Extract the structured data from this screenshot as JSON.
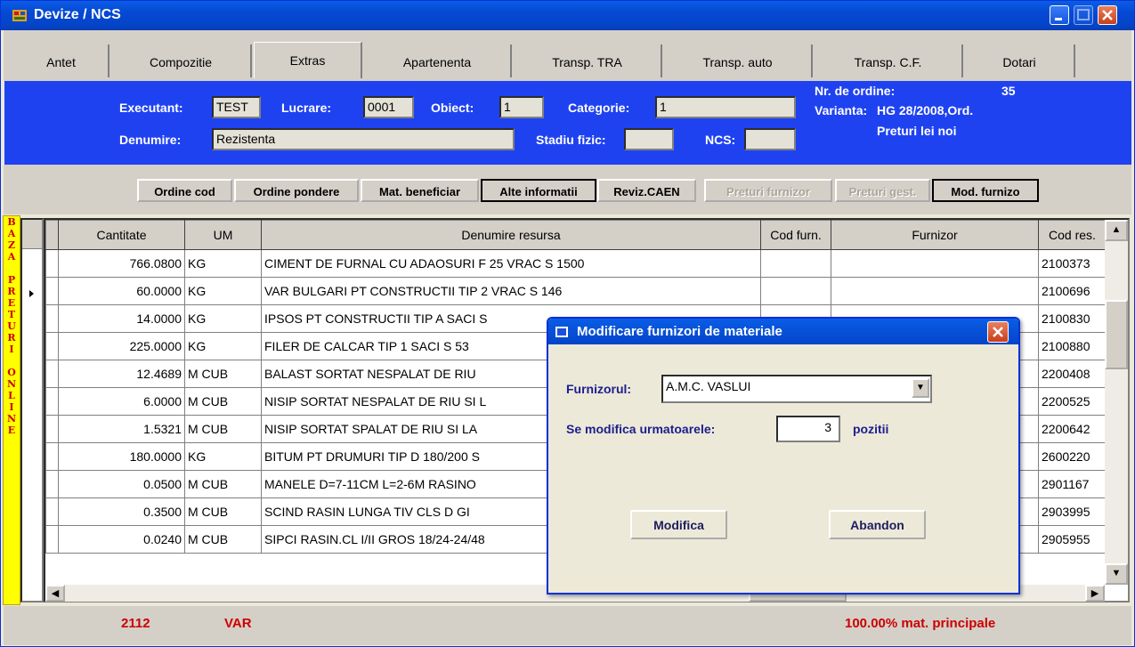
{
  "window": {
    "title": "Devize / NCS"
  },
  "tabs": [
    {
      "label": "Antet"
    },
    {
      "label": "Compozitie"
    },
    {
      "label": "Extras"
    },
    {
      "label": "Apartenenta"
    },
    {
      "label": "Transp. TRA"
    },
    {
      "label": "Transp. auto"
    },
    {
      "label": "Transp. C.F."
    },
    {
      "label": "Dotari"
    }
  ],
  "header": {
    "executant_label": "Executant:",
    "executant_value": "TEST",
    "lucrare_label": "Lucrare:",
    "lucrare_value": "0001",
    "obiect_label": "Obiect:",
    "obiect_value": "1",
    "categorie_label": "Categorie:",
    "categorie_value": "1",
    "denumire_label": "Denumire:",
    "denumire_value": "Rezistenta",
    "stadiu_label": "Stadiu fizic:",
    "stadiu_value": "",
    "ncs_label": "NCS:",
    "ncs_value": "",
    "nr_ordine_label": "Nr. de ordine:",
    "nr_ordine_value": "35",
    "varianta_label": "Varianta:",
    "varianta_value": "HG 28/2008,Ord.",
    "preturi_label": "Preturi lei noi"
  },
  "toolbar": [
    {
      "label": "Ordine cod",
      "state": "enabled"
    },
    {
      "label": "Ordine pondere",
      "state": "enabled"
    },
    {
      "label": "Mat. beneficiar",
      "state": "enabled"
    },
    {
      "label": "Alte informatii",
      "state": "selected"
    },
    {
      "label": "Reviz.CAEN",
      "state": "enabled"
    },
    {
      "label": "Preturi furnizor",
      "state": "disabled"
    },
    {
      "label": "Preturi gest.",
      "state": "disabled"
    },
    {
      "label": "Mod. furnizo",
      "state": "selected"
    }
  ],
  "side_label": [
    "B",
    "A",
    "Z",
    "A",
    "",
    "P",
    "R",
    "E",
    "T",
    "U",
    "R",
    "I",
    "",
    "O",
    "N",
    "L",
    "I",
    "N",
    "E"
  ],
  "table": {
    "columns": [
      "Cantitate",
      "UM",
      "Denumire resursa",
      "Cod furn.",
      "Furnizor",
      "Cod res."
    ],
    "rows": [
      [
        "766.0800",
        "KG",
        "CIMENT DE FURNAL  CU ADAOSURI   F  25  VRAC   S  1500",
        "",
        "",
        "2100373"
      ],
      [
        "60.0000",
        "KG",
        "VAR BULGARI PT CONSTRUCTII  TIP 2     VRAC   S  146",
        "",
        "",
        "2100696"
      ],
      [
        "14.0000",
        "KG",
        "IPSOS PT CONSTRUCTII TIP A  SACI S",
        "",
        "",
        "2100830"
      ],
      [
        "225.0000",
        "KG",
        "FILER DE CALCAR     TIP 1  SACI S 53",
        "",
        "",
        "2100880"
      ],
      [
        "12.4689",
        "M CUB",
        "BALAST SORTAT NESPALAT DE RIU",
        "",
        "",
        "2200408"
      ],
      [
        "6.0000",
        "M CUB",
        "NISIP SORTAT NESPALAT DE RIU SI L",
        "",
        "",
        "2200525"
      ],
      [
        "1.5321",
        "M CUB",
        "NISIP SORTAT   SPALAT DE RIU SI LA",
        "",
        "",
        "2200642"
      ],
      [
        "180.0000",
        "KG",
        "BITUM PT DRUMURI TIP D 180/200    S",
        "",
        "",
        "2600220"
      ],
      [
        "0.0500",
        "M CUB",
        "MANELE   D=7-11CM  L=2-6M  RASINO",
        "",
        "",
        "2901167"
      ],
      [
        "0.3500",
        "M CUB",
        "SCIND RASIN LUNGA   TIV CLS D   GI",
        "",
        "",
        "2903995"
      ],
      [
        "0.0240",
        "M CUB",
        "SIPCI RASIN.CL I/II GROS 18/24-24/48",
        "",
        "",
        "2905955"
      ]
    ],
    "current_row_index": 1
  },
  "status": {
    "left_code": "2112",
    "left_text": "VAR",
    "right_text": "100.00% mat. principale"
  },
  "dialog": {
    "title": "Modificare furnizori de materiale",
    "furnizor_label": "Furnizorul:",
    "furnizor_value": "A.M.C. VASLUI",
    "modifica_label": "Se modifica urmatoarele:",
    "modifica_value": "3",
    "pozitii_label": "pozitii",
    "ok_button": "Modifica",
    "cancel_button": "Abandon"
  },
  "colors": {
    "header_bg": "#1f42f1",
    "accent_red": "#e31313",
    "side_bar": "#ffff00"
  }
}
